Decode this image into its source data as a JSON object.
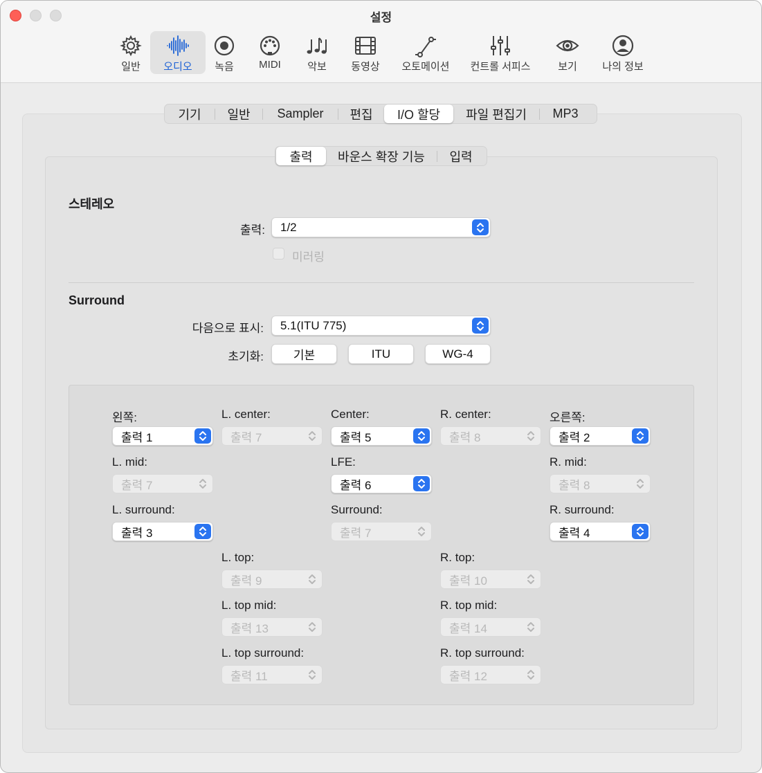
{
  "window": {
    "title": "설정"
  },
  "toolbar": [
    {
      "id": "general",
      "label": "일반",
      "icon": "gear-icon"
    },
    {
      "id": "audio",
      "label": "오디오",
      "icon": "waveform-icon",
      "selected": true
    },
    {
      "id": "record",
      "label": "녹음",
      "icon": "record-icon"
    },
    {
      "id": "midi",
      "label": "MIDI",
      "icon": "midi-icon"
    },
    {
      "id": "score",
      "label": "악보",
      "icon": "notes-icon"
    },
    {
      "id": "video",
      "label": "동영상",
      "icon": "film-icon"
    },
    {
      "id": "automation",
      "label": "오토메이션",
      "icon": "automation-icon"
    },
    {
      "id": "control",
      "label": "컨트롤 서피스",
      "icon": "sliders-icon"
    },
    {
      "id": "view",
      "label": "보기",
      "icon": "eye-icon"
    },
    {
      "id": "account",
      "label": "나의 정보",
      "icon": "person-icon"
    }
  ],
  "tabs": [
    "기기",
    "일반",
    "Sampler",
    "편집",
    "I/O 할당",
    "파일 편집기",
    "MP3"
  ],
  "selected_tab": "I/O 할당",
  "subtabs": [
    "출력",
    "바운스 확장 기능",
    "입력"
  ],
  "selected_subtab": "출력",
  "stereo": {
    "title": "스테레오",
    "output_label": "출력:",
    "output_value": "1/2",
    "mirroring_label": "미러링"
  },
  "surround": {
    "title": "Surround",
    "show_as_label": "다음으로 표시:",
    "show_as_value": "5.1(ITU 775)",
    "init_label": "초기화:",
    "init_buttons": [
      "기본",
      "ITU",
      "WG-4"
    ]
  },
  "channels": {
    "left": {
      "label": "왼쪽:",
      "value": "출력 1",
      "enabled": true
    },
    "l_center": {
      "label": "L. center:",
      "value": "출력 7",
      "enabled": false
    },
    "center": {
      "label": "Center:",
      "value": "출력 5",
      "enabled": true
    },
    "r_center": {
      "label": "R. center:",
      "value": "출력 8",
      "enabled": false
    },
    "right": {
      "label": "오른쪽:",
      "value": "출력 2",
      "enabled": true
    },
    "l_mid": {
      "label": "L. mid:",
      "value": "출력 7",
      "enabled": false
    },
    "lfe": {
      "label": "LFE:",
      "value": "출력 6",
      "enabled": true
    },
    "r_mid": {
      "label": "R. mid:",
      "value": "출력 8",
      "enabled": false
    },
    "l_surround": {
      "label": "L. surround:",
      "value": "출력 3",
      "enabled": true
    },
    "surround": {
      "label": "Surround:",
      "value": "출력 7",
      "enabled": false
    },
    "r_surround": {
      "label": "R. surround:",
      "value": "출력 4",
      "enabled": true
    },
    "l_top": {
      "label": "L. top:",
      "value": "출력 9",
      "enabled": false
    },
    "r_top": {
      "label": "R. top:",
      "value": "출력 10",
      "enabled": false
    },
    "l_top_mid": {
      "label": "L. top mid:",
      "value": "출력 13",
      "enabled": false
    },
    "r_top_mid": {
      "label": "R. top mid:",
      "value": "출력 14",
      "enabled": false
    },
    "l_top_surround": {
      "label": "L. top surround:",
      "value": "출력 11",
      "enabled": false
    },
    "r_top_surround": {
      "label": "R. top surround:",
      "value": "출력 12",
      "enabled": false
    }
  },
  "colors": {
    "accent": "#2a74f0",
    "selected_label": "#1f63d6",
    "close": "#fe5f57"
  }
}
